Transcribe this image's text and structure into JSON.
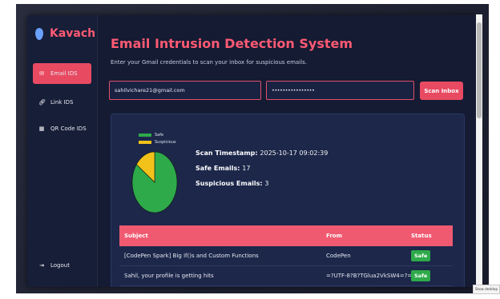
{
  "app": {
    "name": "Kavach"
  },
  "sidebar": {
    "items": [
      {
        "label": "Email IDS",
        "icon": "email-icon",
        "active": true
      },
      {
        "label": "Link IDS",
        "icon": "link-icon",
        "active": false
      },
      {
        "label": "QR Code IDS",
        "icon": "qr-code-icon",
        "active": false
      }
    ],
    "logout": {
      "label": "Logout",
      "icon": "logout-icon"
    }
  },
  "main": {
    "title": "Email Intrusion Detection System",
    "subtitle": "Enter your Gmail credentials to scan your inbox for suspicious emails.",
    "email_value": "sahilvichare21@gmail.com",
    "password_value": "••••••••••••••••",
    "scan_button": "Scan Inbox"
  },
  "results": {
    "legend": {
      "safe": "Safe",
      "suspicious": "Suspicious"
    },
    "timestamp_label": "Scan Timestamp:",
    "timestamp_value": "2025-10-17 09:02:39",
    "safe_label": "Safe Emails:",
    "safe_value": "17",
    "suspicious_label": "Suspicious Emails:",
    "suspicious_value": "3",
    "colors": {
      "safe": "#2eaa4a",
      "suspicious": "#f2c21a"
    },
    "table": {
      "headers": {
        "subject": "Subject",
        "from": "From",
        "status": "Status"
      },
      "rows": [
        {
          "subject": "[CodePen Spark] Big if()s and Custom Functions",
          "from": "CodePen",
          "status": "Safe"
        },
        {
          "subject": "Sahil, your profile is getting hits",
          "from": "=?UTF-8?B?TGlua2VkSW4=?=",
          "status": "Safe"
        }
      ]
    }
  },
  "tooltip": "Show desktop"
}
